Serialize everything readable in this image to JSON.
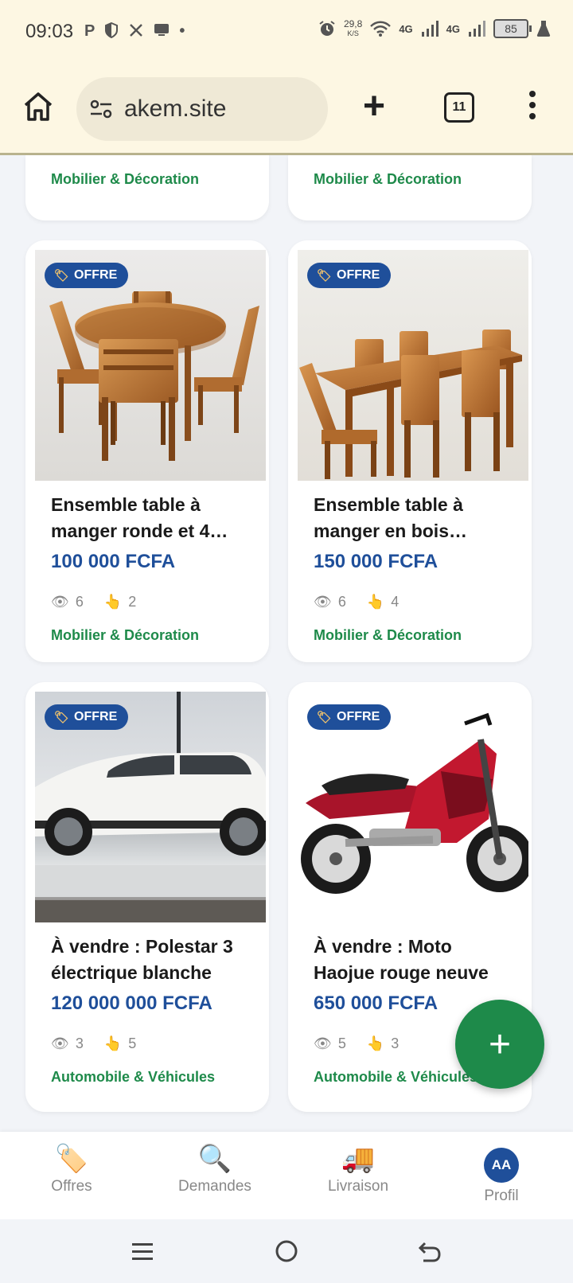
{
  "status_bar": {
    "time": "09:03",
    "left_icons": [
      "P",
      "shield-icon",
      "x-icon",
      "screen-icon",
      "•"
    ],
    "net_speed_value": "29,8",
    "net_speed_unit": "K/S",
    "network_1": "4G",
    "network_2": "4G",
    "battery": "85"
  },
  "browser": {
    "url": "akem.site",
    "tab_count": "11"
  },
  "cards_top": [
    {
      "category": "Mobilier & Décoration"
    },
    {
      "category": "Mobilier & Décoration"
    }
  ],
  "cards": [
    {
      "badge": "OFFRE",
      "title_line1": "Ensemble table à",
      "title_line2": "manger ronde et 4…",
      "price": "100 000 FCFA",
      "views": "6",
      "clicks": "2",
      "category": "Mobilier & Décoration"
    },
    {
      "badge": "OFFRE",
      "title_line1": "Ensemble table à",
      "title_line2": "manger en bois…",
      "price": "150 000 FCFA",
      "views": "6",
      "clicks": "4",
      "category": "Mobilier & Décoration"
    },
    {
      "badge": "OFFRE",
      "title_line1": "À vendre : Polestar 3",
      "title_line2": "électrique blanche",
      "price": "120 000 000 FCFA",
      "views": "3",
      "clicks": "5",
      "category": "Automobile & Véhicules"
    },
    {
      "badge": "OFFRE",
      "title_line1": "À vendre : Moto",
      "title_line2": "Haojue rouge neuve",
      "price": "650 000 FCFA",
      "views": "5",
      "clicks": "3",
      "category": "Automobile & Véhicules"
    }
  ],
  "icons": {
    "views": "👁",
    "clicks": "👆",
    "badge": "🏷"
  },
  "fab_label": "+",
  "bottom_nav": [
    {
      "label": "Offres",
      "icon": "🏷️"
    },
    {
      "label": "Demandes",
      "icon": "🔍"
    },
    {
      "label": "Livraison",
      "icon": "🚚"
    },
    {
      "label": "Profil",
      "avatar": "AA"
    }
  ],
  "colors": {
    "brand_blue": "#1f4f9a",
    "brand_green": "#1e8a4a",
    "browser_bg": "#fdf7e3"
  }
}
